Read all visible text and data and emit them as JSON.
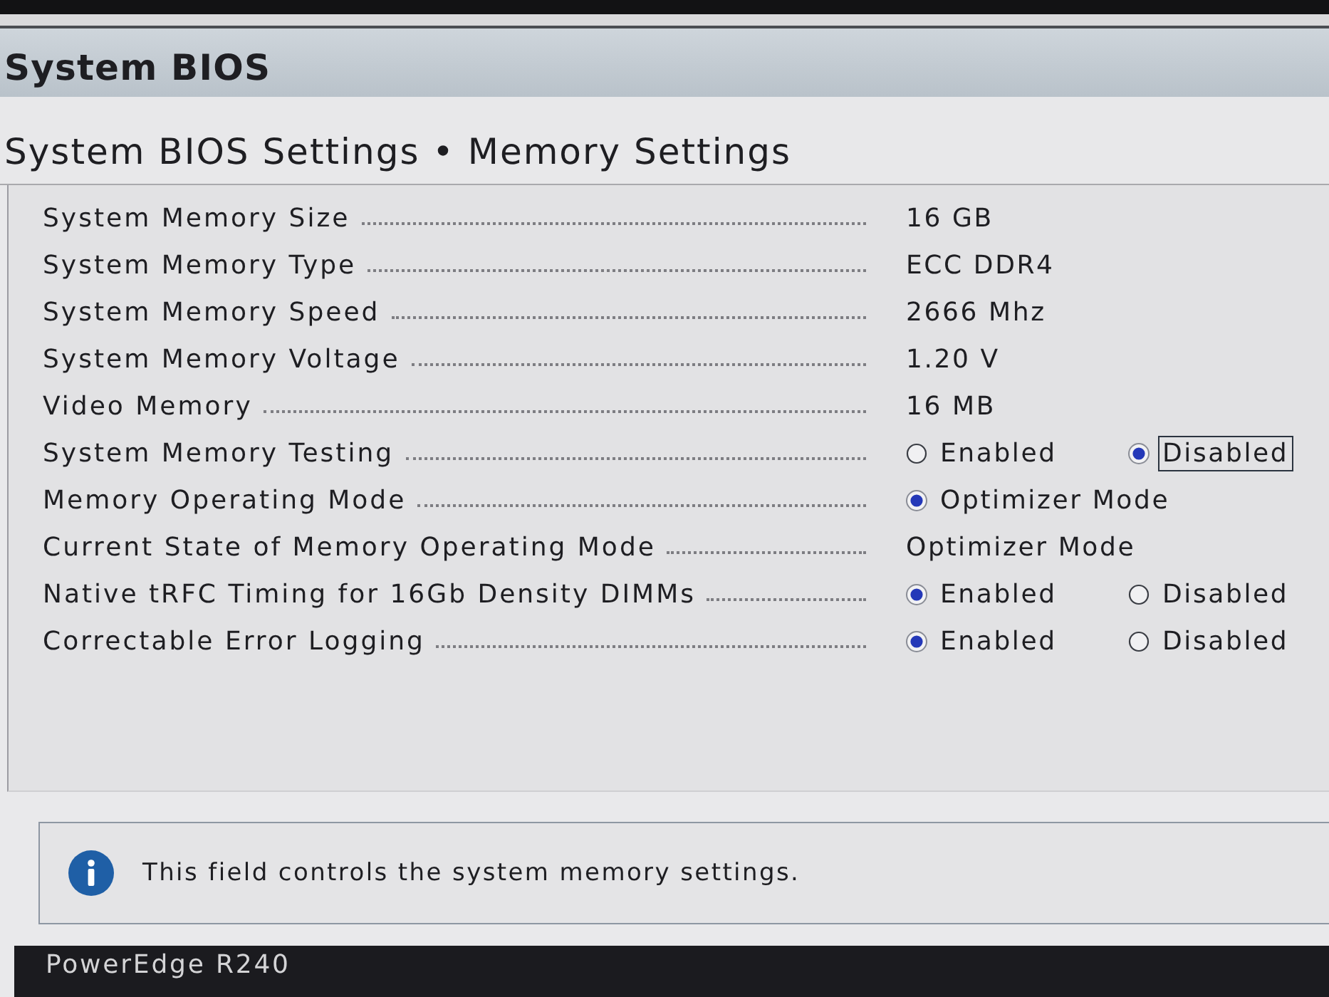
{
  "header": {
    "title": "System BIOS"
  },
  "page": {
    "breadcrumb": "System BIOS Settings • Memory Settings"
  },
  "settings": [
    {
      "kind": "info",
      "label": "System Memory Size",
      "value": "16 GB"
    },
    {
      "kind": "info",
      "label": "System Memory Type",
      "value": "ECC DDR4"
    },
    {
      "kind": "info",
      "label": "System Memory Speed",
      "value": "2666 Mhz"
    },
    {
      "kind": "info",
      "label": "System Memory Voltage",
      "value": "1.20 V"
    },
    {
      "kind": "info",
      "label": "Video Memory",
      "value": "16 MB"
    },
    {
      "kind": "radio",
      "label": "System Memory Testing",
      "options": [
        {
          "label": "Enabled",
          "selected": false,
          "focused": false
        },
        {
          "label": "Disabled",
          "selected": true,
          "focused": true
        }
      ]
    },
    {
      "kind": "radio",
      "label": "Memory Operating Mode",
      "options": [
        {
          "label": "Optimizer Mode",
          "selected": true,
          "focused": false
        }
      ]
    },
    {
      "kind": "info",
      "label": "Current State of Memory Operating Mode",
      "value": "Optimizer Mode"
    },
    {
      "kind": "radio",
      "label": "Native tRFC Timing for 16Gb Density DIMMs",
      "options": [
        {
          "label": "Enabled",
          "selected": true,
          "focused": false
        },
        {
          "label": "Disabled",
          "selected": false,
          "focused": false
        }
      ]
    },
    {
      "kind": "radio",
      "label": "Correctable Error Logging",
      "options": [
        {
          "label": "Enabled",
          "selected": true,
          "focused": false
        },
        {
          "label": "Disabled",
          "selected": false,
          "focused": false
        }
      ]
    }
  ],
  "help": {
    "text": "This field controls the system memory settings."
  },
  "footer": {
    "model": "PowerEdge R240"
  }
}
